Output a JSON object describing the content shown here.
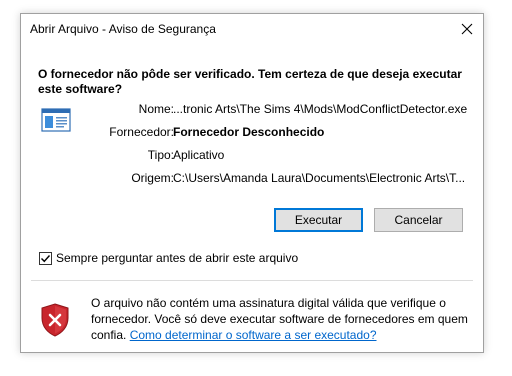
{
  "window": {
    "title": "Abrir Arquivo - Aviso de Segurança",
    "close_symbol": "✕"
  },
  "heading": "O fornecedor não pôde ser verificado. Tem certeza de que deseja executar este software?",
  "details": {
    "name_label": "Nome:",
    "name_value": "...tronic Arts\\The Sims 4\\Mods\\ModConflictDetector.exe",
    "publisher_label": "Fornecedor:",
    "publisher_value": "Fornecedor Desconhecido",
    "type_label": "Tipo:",
    "type_value": "Aplicativo",
    "origin_label": "Origem:",
    "origin_value": "C:\\Users\\Amanda Laura\\Documents\\Electronic Arts\\T..."
  },
  "buttons": {
    "run": "Executar",
    "cancel": "Cancelar"
  },
  "checkbox": {
    "label": "Sempre perguntar antes de abrir este arquivo",
    "checked": true
  },
  "warning": {
    "text": "O arquivo não contém uma assinatura digital válida que verifique o fornecedor. Você só deve executar software de fornecedores em quem confia.",
    "link": "Como determinar o software a ser executado?"
  },
  "icons": {
    "file": "application-file-icon",
    "shield": "security-shield-icon",
    "check": "checkmark-icon"
  },
  "colors": {
    "accent": "#0078d7",
    "link": "#0066cc",
    "shield_red": "#c8252c"
  }
}
